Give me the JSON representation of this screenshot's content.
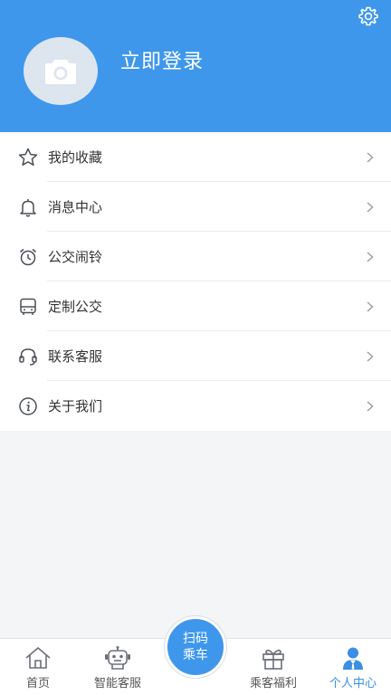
{
  "header": {
    "login_label": "立即登录",
    "bg_color": "#3f97ec",
    "settings_icon": "gear-icon",
    "avatar_icon": "camera-icon"
  },
  "menu": {
    "items": [
      {
        "label": "我的收藏",
        "icon": "star-icon"
      },
      {
        "label": "消息中心",
        "icon": "bell-icon"
      },
      {
        "label": "公交闹铃",
        "icon": "alarm-clock-icon"
      },
      {
        "label": "定制公交",
        "icon": "bus-icon"
      },
      {
        "label": "联系客服",
        "icon": "headset-icon"
      },
      {
        "label": "关于我们",
        "icon": "info-icon"
      }
    ]
  },
  "scan": {
    "line1": "扫码",
    "line2": "乘车"
  },
  "tabbar": {
    "active_color": "#3b8fe4",
    "tabs": [
      {
        "label": "首页",
        "icon": "home-icon"
      },
      {
        "label": "智能客服",
        "icon": "robot-icon"
      },
      {
        "label": "乘客福利",
        "icon": "gift-icon"
      },
      {
        "label": "个人中心",
        "icon": "user-icon",
        "active": true
      }
    ]
  }
}
